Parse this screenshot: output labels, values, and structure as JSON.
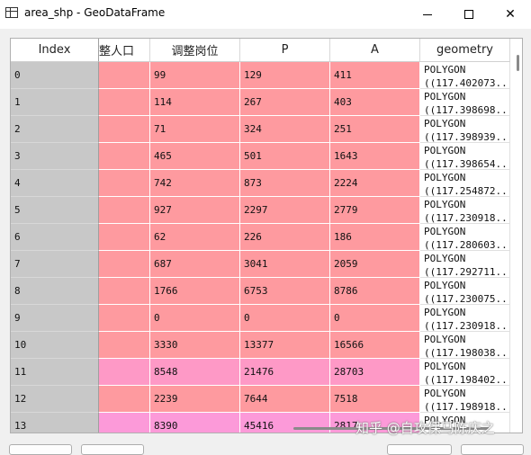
{
  "window": {
    "title": "area_shp - GeoDataFrame"
  },
  "table": {
    "index_header": "Index",
    "columns": [
      "整人口",
      "调整岗位",
      "P",
      "A",
      "geometry"
    ],
    "rows": [
      {
        "index": "0",
        "c1": "",
        "c2": "99",
        "p": "129",
        "a": "411",
        "geo1": "POLYGON",
        "geo2": "((117.402073..."
      },
      {
        "index": "1",
        "c1": "",
        "c2": "114",
        "p": "267",
        "a": "403",
        "geo1": "POLYGON",
        "geo2": "((117.398698..."
      },
      {
        "index": "2",
        "c1": "",
        "c2": "71",
        "p": "324",
        "a": "251",
        "geo1": "POLYGON",
        "geo2": "((117.398939..."
      },
      {
        "index": "3",
        "c1": "",
        "c2": "465",
        "p": "501",
        "a": "1643",
        "geo1": "POLYGON",
        "geo2": "((117.398654..."
      },
      {
        "index": "4",
        "c1": "",
        "c2": "742",
        "p": "873",
        "a": "2224",
        "geo1": "POLYGON",
        "geo2": "((117.254872..."
      },
      {
        "index": "5",
        "c1": "",
        "c2": "927",
        "p": "2297",
        "a": "2779",
        "geo1": "POLYGON",
        "geo2": "((117.230918..."
      },
      {
        "index": "6",
        "c1": "",
        "c2": "62",
        "p": "226",
        "a": "186",
        "geo1": "POLYGON",
        "geo2": "((117.280603..."
      },
      {
        "index": "7",
        "c1": "",
        "c2": "687",
        "p": "3041",
        "a": "2059",
        "geo1": "POLYGON",
        "geo2": "((117.292711..."
      },
      {
        "index": "8",
        "c1": "",
        "c2": "1766",
        "p": "6753",
        "a": "8786",
        "geo1": "POLYGON",
        "geo2": "((117.230075..."
      },
      {
        "index": "9",
        "c1": "",
        "c2": "0",
        "p": "0",
        "a": "0",
        "geo1": "POLYGON",
        "geo2": "((117.230918..."
      },
      {
        "index": "10",
        "c1": "",
        "c2": "3330",
        "p": "13377",
        "a": "16566",
        "geo1": "POLYGON",
        "geo2": "((117.198038..."
      },
      {
        "index": "11",
        "c1": "",
        "c2": "8548",
        "p": "21476",
        "a": "28703",
        "geo1": "POLYGON",
        "geo2": "((117.198402..."
      },
      {
        "index": "12",
        "c1": "",
        "c2": "2239",
        "p": "7644",
        "a": "7518",
        "geo1": "POLYGON",
        "geo2": "((117.198918..."
      },
      {
        "index": "13",
        "c1": "",
        "c2": "8390",
        "p": "45416",
        "a": "2817",
        "geo1": "POLYGON",
        "geo2": ""
      }
    ]
  },
  "colors": {
    "cell_salmon": "#fe9a9f",
    "cell_pink": "#fe99c6",
    "cell_magenta": "#fc9ad9",
    "index_bg": "#c8c8c8"
  },
  "watermark": "知乎 @自攻保马陈庆之",
  "icons": {
    "app": "table-icon",
    "minimize": "minimize-icon",
    "maximize": "maximize-icon",
    "close": "close-icon"
  }
}
